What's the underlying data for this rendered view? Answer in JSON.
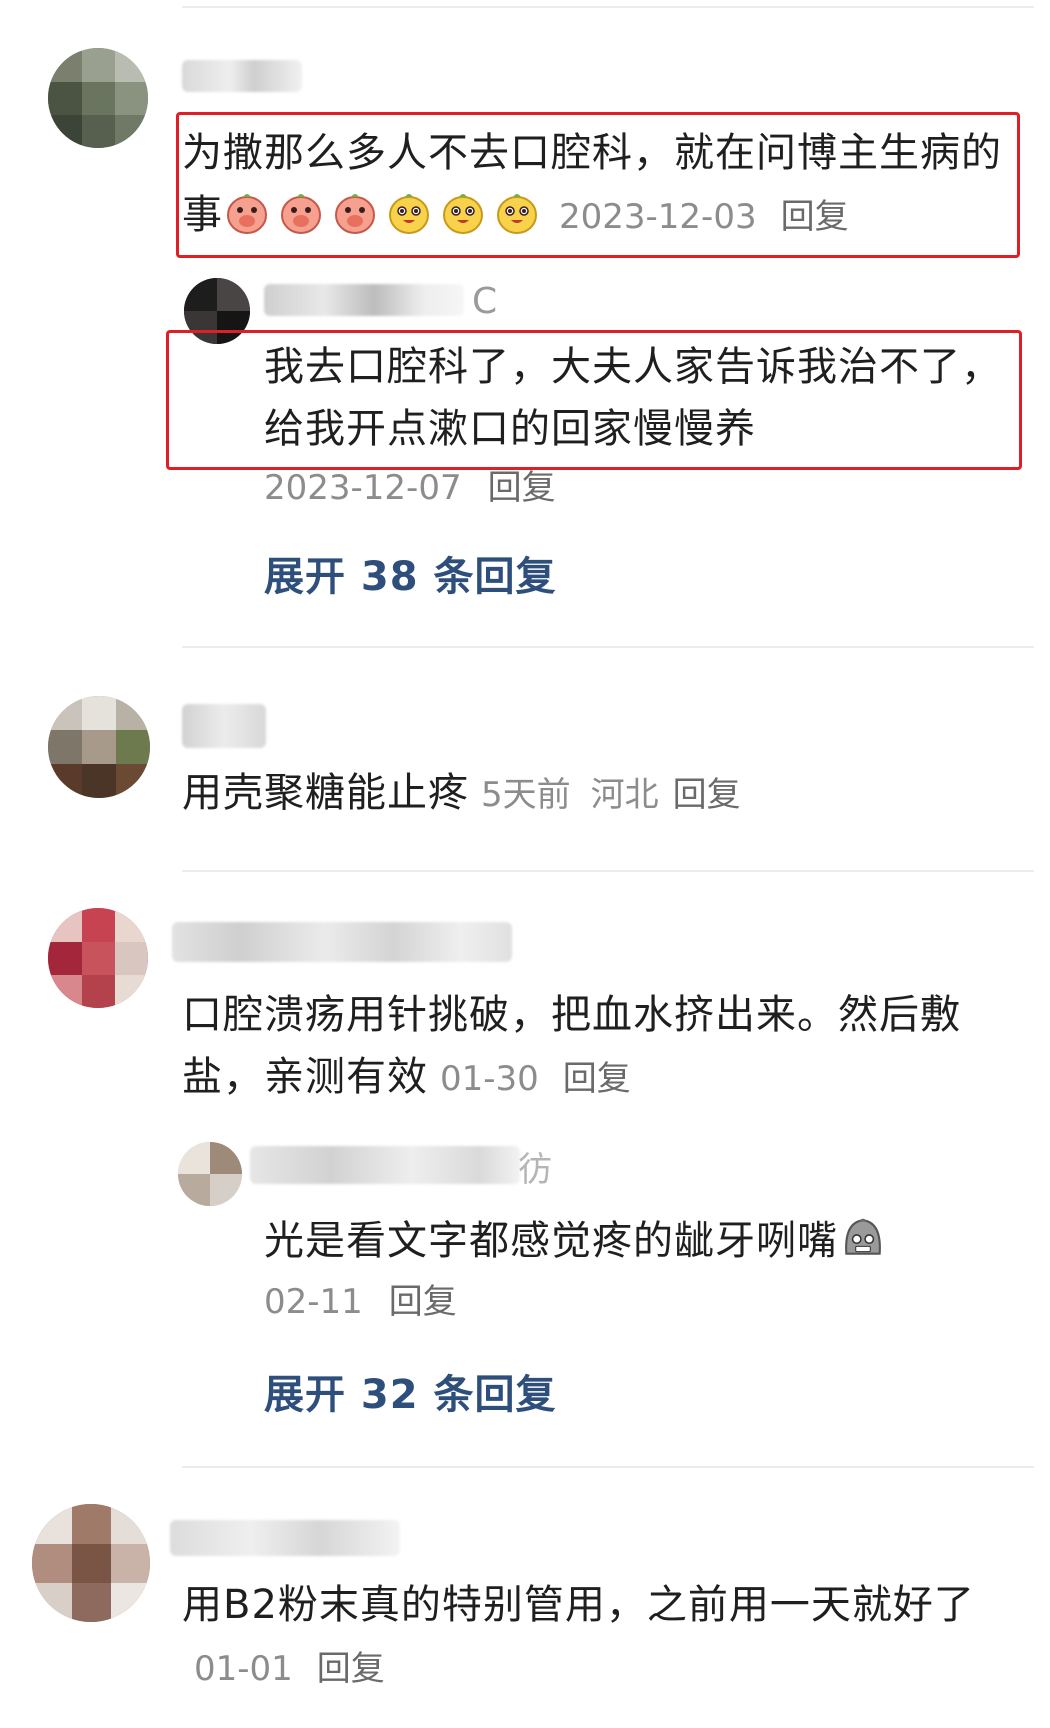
{
  "comments": [
    {
      "text": "为撒那么多人不去口腔科，就在问博主生病的事",
      "emojis": [
        "peach-cover-mouth-emoji",
        "peach-cover-mouth-emoji",
        "peach-cover-mouth-emoji",
        "yellow-smile-emoji",
        "yellow-smile-emoji",
        "yellow-smile-emoji"
      ],
      "time": "2023-12-03",
      "reply_label": "回复",
      "sub_reply": {
        "name_suffix": "C",
        "text": "我去口腔科了，大夫人家告诉我治不了，给我开点漱口的回家慢慢养",
        "time": "2023-12-07",
        "reply_label": "回复"
      },
      "expand_label": "展开 38 条回复"
    },
    {
      "text": "用壳聚糖能止疼",
      "time": "5天前",
      "location": "河北",
      "reply_label": "回复"
    },
    {
      "text": "口腔溃疡用针挑破，把血水挤出来。然后敷盐，亲测有效",
      "time": "01-30",
      "reply_label": "回复",
      "sub_reply": {
        "name_suffix": "彷",
        "text": "光是看文字都感觉疼的龇牙咧嘴",
        "emoji": "gray-grimace-emoji",
        "time": "02-11",
        "reply_label": "回复"
      },
      "expand_label": "展开 32 条回复"
    },
    {
      "text": "用B2粉末真的特别管用，之前用一天就好了",
      "time": "01-01",
      "reply_label": "回复"
    }
  ],
  "colors": {
    "highlight_box": "#e01f24",
    "expand_link": "#2e4f7c",
    "meta_gray": "#8c8c8c"
  }
}
